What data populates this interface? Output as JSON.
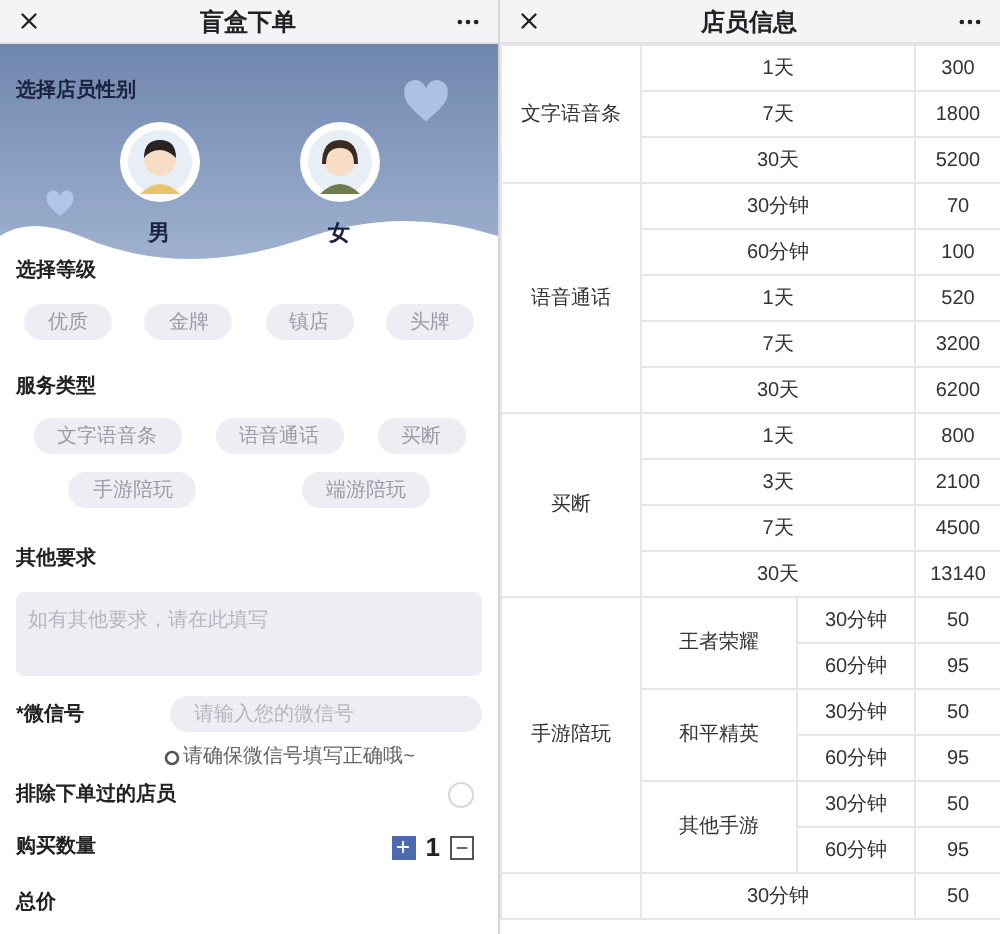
{
  "order_panel": {
    "title": "盲盒下单",
    "gender": {
      "label": "选择店员性别",
      "options": [
        {
          "label": "男",
          "kind": "boy"
        },
        {
          "label": "女",
          "kind": "girl"
        }
      ]
    },
    "level": {
      "label": "选择等级",
      "options": [
        "优质",
        "金牌",
        "镇店",
        "头牌"
      ]
    },
    "service": {
      "label": "服务类型",
      "rows": [
        [
          "文字语音条",
          "语音通话",
          "买断"
        ],
        [
          "手游陪玩",
          "端游陪玩"
        ]
      ]
    },
    "other": {
      "label": "其他要求",
      "placeholder": "如有其他要求，请在此填写"
    },
    "wechat": {
      "label": "*微信号",
      "placeholder": "请输入您的微信号",
      "hint": "请确保微信号填写正确哦~"
    },
    "exclude": {
      "label": "排除下单过的店员",
      "checked": false
    },
    "quantity": {
      "label": "购买数量",
      "value": "1"
    },
    "total": {
      "label": "总价"
    }
  },
  "info_panel": {
    "title": "店员信息",
    "groups": [
      {
        "category": "文字语音条",
        "rows": [
          {
            "duration": "1天",
            "price": "300"
          },
          {
            "duration": "7天",
            "price": "1800"
          },
          {
            "duration": "30天",
            "price": "5200"
          }
        ]
      },
      {
        "category": "语音通话",
        "rows": [
          {
            "duration": "30分钟",
            "price": "70"
          },
          {
            "duration": "60分钟",
            "price": "100"
          },
          {
            "duration": "1天",
            "price": "520"
          },
          {
            "duration": "7天",
            "price": "3200"
          },
          {
            "duration": "30天",
            "price": "6200"
          }
        ]
      },
      {
        "category": "买断",
        "rows": [
          {
            "duration": "1天",
            "price": "800"
          },
          {
            "duration": "3天",
            "price": "2100"
          },
          {
            "duration": "7天",
            "price": "4500"
          },
          {
            "duration": "30天",
            "price": "13140"
          }
        ]
      },
      {
        "category": "手游陪玩",
        "games": [
          {
            "name": "王者荣耀",
            "rows": [
              {
                "duration": "30分钟",
                "price": "50"
              },
              {
                "duration": "60分钟",
                "price": "95"
              }
            ]
          },
          {
            "name": "和平精英",
            "rows": [
              {
                "duration": "30分钟",
                "price": "50"
              },
              {
                "duration": "60分钟",
                "price": "95"
              }
            ]
          },
          {
            "name": "其他手游",
            "rows": [
              {
                "duration": "30分钟",
                "price": "50"
              },
              {
                "duration": "60分钟",
                "price": "95"
              }
            ]
          }
        ]
      },
      {
        "rows": [
          {
            "duration": "30分钟",
            "price": "50"
          }
        ]
      }
    ]
  }
}
